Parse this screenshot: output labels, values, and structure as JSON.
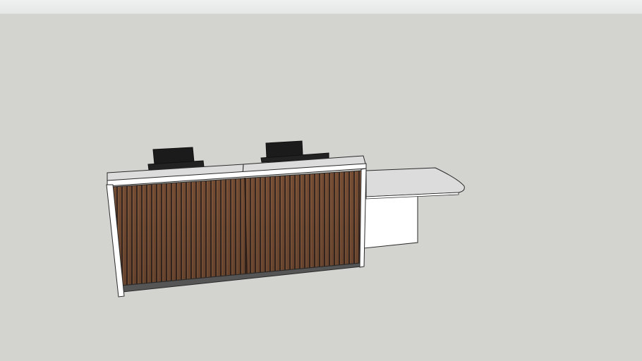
{
  "viewer": {
    "background_color": "#d3d3cf",
    "strip_color": "#eef0f0"
  },
  "model": {
    "subject": "reception-desk",
    "colors": {
      "countertop": "#dcdcdc",
      "countertop_edge": "#ffffff",
      "wood_slat": "#7a5036",
      "wood_gap": "#3b2a22",
      "plinth": "#555555",
      "side_panel": "#ffffff",
      "chair": "#1b1b1b",
      "outline": "#2a2a2a"
    }
  }
}
